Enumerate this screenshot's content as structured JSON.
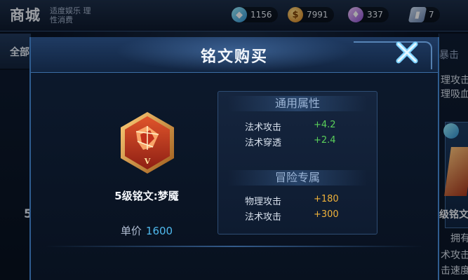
{
  "shop": {
    "title": "商城",
    "slogan": "适度娱乐 理性消费",
    "currencies": [
      {
        "icon": "crystal-icon",
        "amount": "1156"
      },
      {
        "icon": "gold-coin-icon",
        "amount": "7991"
      },
      {
        "icon": "diamond-icon",
        "amount": "337"
      },
      {
        "icon": "ticket-icon",
        "amount": "7"
      }
    ],
    "left_tab": "全部",
    "left_number": "5",
    "right_panel": {
      "header": "暴击",
      "lines_top": [
        "理攻击",
        "理吸血"
      ],
      "title": "级铭文",
      "owned": "拥有",
      "lines_bottom": [
        "术攻击",
        "击速度"
      ]
    }
  },
  "modal": {
    "title": "铭文购买",
    "close_icon": "close-x-icon",
    "rune": {
      "icon": "rune-level5-icon",
      "level_mark": "V",
      "name": "5级铭文:梦魇",
      "price_label": "单价",
      "price_value": "1600"
    },
    "general": {
      "title": "通用属性",
      "rows": [
        {
          "name": "法术攻击",
          "value": "+4.2"
        },
        {
          "name": "法术穿透",
          "value": "+2.4"
        }
      ]
    },
    "adventure": {
      "title": "冒险专属",
      "rows": [
        {
          "name": "物理攻击",
          "value": "+180"
        },
        {
          "name": "法术攻击",
          "value": "+300"
        }
      ]
    }
  },
  "colors": {
    "accent_blue": "#4fb8ec",
    "bonus_green": "#5ad05a",
    "bonus_orange": "#f0b23a"
  }
}
